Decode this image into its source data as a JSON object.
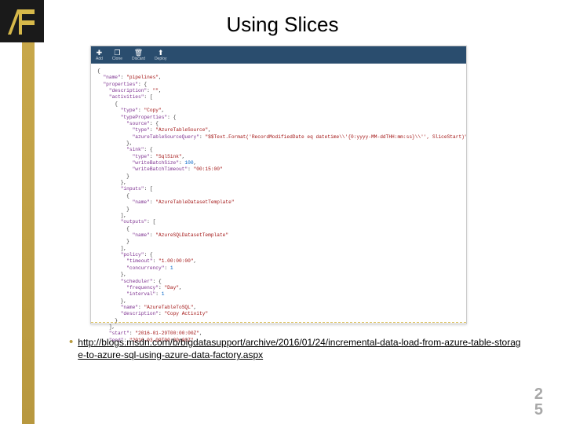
{
  "logo_label": "IA",
  "title": "Using Slices",
  "toolbar": {
    "add": {
      "icon": "✚",
      "label": "Add"
    },
    "clone": {
      "icon": "❐",
      "label": "Clone"
    },
    "discard": {
      "icon": "🗑",
      "label": "Discard"
    },
    "deploy": {
      "icon": "⬆",
      "label": "Deploy"
    }
  },
  "code": {
    "l01a": "\"name\"",
    "l01b": ": ",
    "l01c": "\"pipelines\"",
    "l01d": ",",
    "l02a": "\"properties\"",
    "l02b": ": {",
    "l03a": "\"description\"",
    "l03b": ": ",
    "l03c": "\"\"",
    "l03d": ",",
    "l04a": "\"activities\"",
    "l04b": ": [",
    "l05": "{",
    "l06a": "\"type\"",
    "l06b": ": ",
    "l06c": "\"Copy\"",
    "l06d": ",",
    "l07a": "\"typeProperties\"",
    "l07b": ": {",
    "l08a": "\"source\"",
    "l08b": ": {",
    "l09a": "\"type\"",
    "l09b": ": ",
    "l09c": "\"AzureTableSource\"",
    "l09d": ",",
    "l10a": "\"azureTableSourceQuery\"",
    "l10b": ": ",
    "l10c": "\"$$Text.Format('RecordModifiedDate eq datetime\\\\'{0:yyyy-MM-ddTHH:mm:ss}\\\\'', SliceStart)\"",
    "l11": "},",
    "l12a": "\"sink\"",
    "l12b": ": {",
    "l13a": "\"type\"",
    "l13b": ": ",
    "l13c": "\"SqlSink\"",
    "l13d": ",",
    "l14a": "\"writeBatchSize\"",
    "l14b": ": ",
    "l14c": "100",
    "l14d": ",",
    "l15a": "\"writeBatchTimeout\"",
    "l15b": ": ",
    "l15c": "\"00:15:00\"",
    "l16": "}",
    "l17": "},",
    "l18a": "\"inputs\"",
    "l18b": ": [",
    "l19": "{",
    "l20a": "\"name\"",
    "l20b": ": ",
    "l20c": "\"AzureTableDatasetTemplate\"",
    "l21": "}",
    "l22": "],",
    "l23a": "\"outputs\"",
    "l23b": ": [",
    "l24": "{",
    "l25a": "\"name\"",
    "l25b": ": ",
    "l25c": "\"AzureSQLDatasetTemplate\"",
    "l26": "}",
    "l27": "],",
    "l28a": "\"policy\"",
    "l28b": ": {",
    "l29a": "\"timeout\"",
    "l29b": ": ",
    "l29c": "\"1.00:00:00\"",
    "l29d": ",",
    "l30a": "\"concurrency\"",
    "l30b": ": ",
    "l30c": "1",
    "l31": "},",
    "l32a": "\"scheduler\"",
    "l32b": ": {",
    "l33a": "\"frequency\"",
    "l33b": ": ",
    "l33c": "\"Day\"",
    "l33d": ",",
    "l34a": "\"interval\"",
    "l34b": ": ",
    "l34c": "1",
    "l35": "},",
    "l36a": "\"name\"",
    "l36b": ": ",
    "l36c": "\"AzureTableToSQL\"",
    "l36d": ",",
    "l37a": "\"description\"",
    "l37b": ": ",
    "l37c": "\"Copy Activity\"",
    "l38": "}",
    "l39": "],",
    "l40a": "\"start\"",
    "l40b": ": ",
    "l40c": "\"2016-01-29T00:00:00Z\"",
    "l40d": ",",
    "l41a": "\"end\"",
    "l41b": ": ",
    "l41c": "\"2016-03-09T00:00:00Z\""
  },
  "bullet_link": "http://blogs.msdn.com/b/bigdatasupport/archive/2016/01/24/incremental-data-load-from-azure-table-storage-to-azure-sql-using-azure-data-factory.aspx",
  "page_number": {
    "top": "2",
    "bottom": "5"
  }
}
